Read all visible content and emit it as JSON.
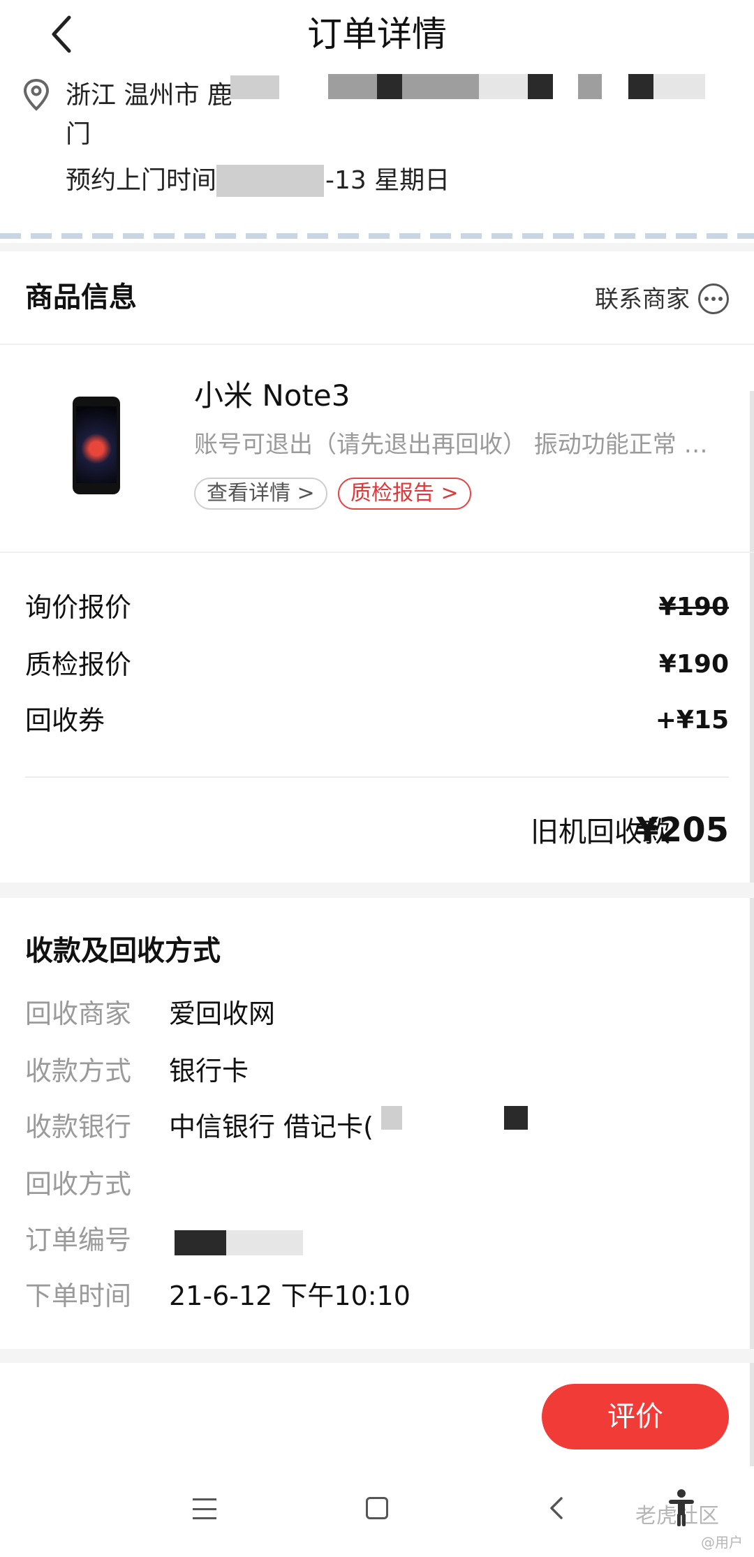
{
  "header": {
    "title": "订单详情"
  },
  "address": {
    "line1": "浙江 温州市 鹿",
    "line2": "门",
    "appointment_label": "预约上门时间",
    "appointment_date": "-13 星期日"
  },
  "goods": {
    "section_title": "商品信息",
    "contact_label": "联系商家",
    "product_name": "小米 Note3",
    "product_desc": "账号可退出（请先退出再回收） 振动功能正常 …",
    "tag_detail": "查看详情 >",
    "tag_report": "质检报告 >"
  },
  "prices": {
    "inquiry_label": "询价报价",
    "inquiry_value": "¥190",
    "inspection_label": "质检报价",
    "inspection_value": "¥190",
    "coupon_label": "回收券",
    "coupon_value": "+¥15",
    "total_label": "旧机回收款",
    "total_value": "¥205"
  },
  "payment": {
    "section_title": "收款及回收方式",
    "rows": [
      {
        "label": "回收商家",
        "value": "爱回收网"
      },
      {
        "label": "收款方式",
        "value": "银行卡"
      },
      {
        "label": "收款银行",
        "value": "中信银行 借记卡("
      },
      {
        "label": "回收方式",
        "value": ""
      },
      {
        "label": "订单编号",
        "value": ""
      },
      {
        "label": "下单时间",
        "value": "21-6-12 下午10:10"
      }
    ]
  },
  "actions": {
    "rate_label": "评价"
  },
  "watermark": {
    "main": "老虎社区",
    "sub": "@用户"
  }
}
